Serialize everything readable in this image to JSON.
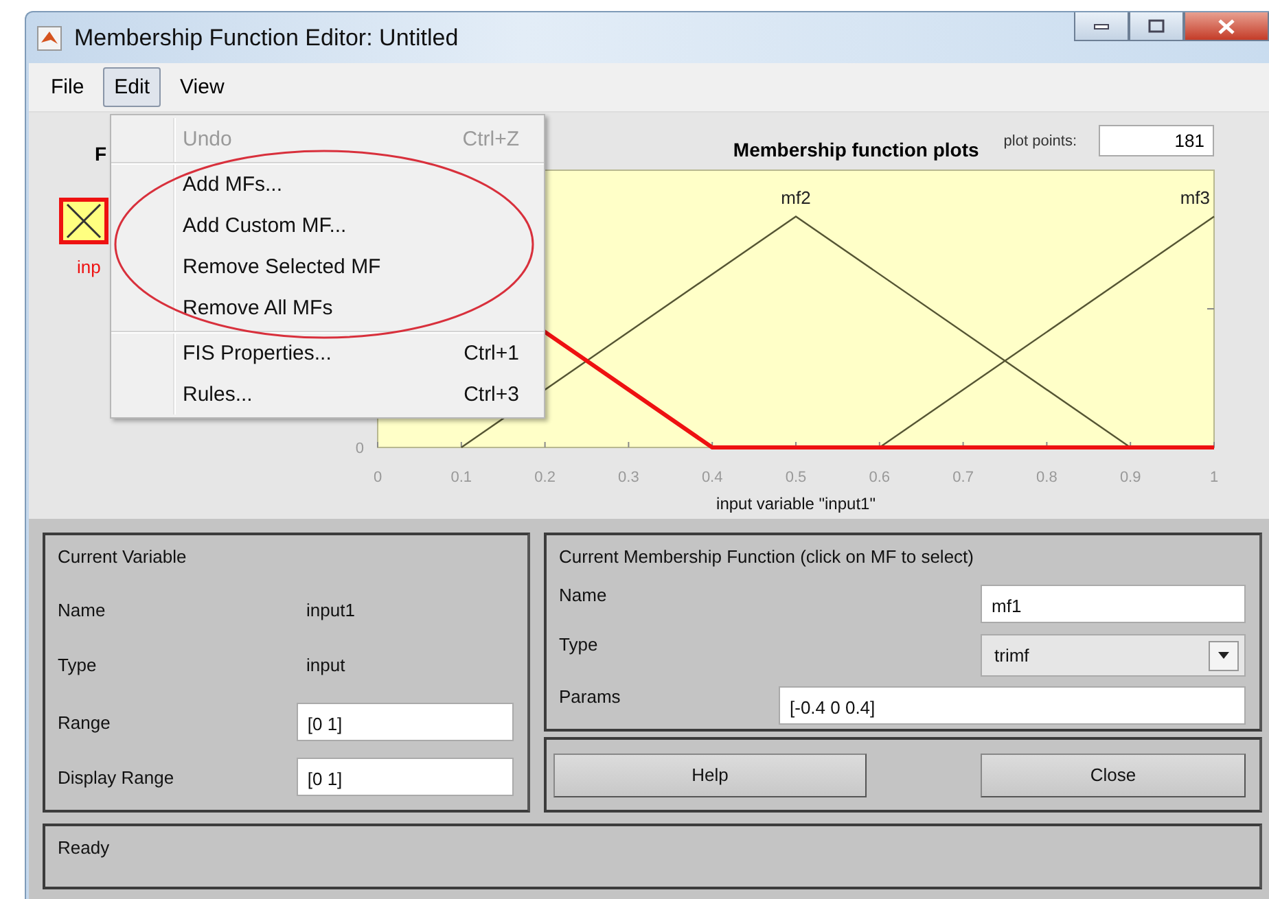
{
  "window": {
    "title": "Membership Function Editor: Untitled"
  },
  "menu_bar": [
    {
      "label": "File",
      "selected": false
    },
    {
      "label": "Edit",
      "selected": true
    },
    {
      "label": "View",
      "selected": false
    }
  ],
  "edit_menu": {
    "items": [
      {
        "label": "Undo",
        "shortcut": "Ctrl+Z",
        "disabled": true,
        "separator_before": false
      },
      {
        "label": "Add MFs...",
        "disabled": false,
        "separator_before": true
      },
      {
        "label": "Add Custom MF...",
        "disabled": false,
        "separator_before": false
      },
      {
        "label": "Remove Selected MF",
        "disabled": false,
        "separator_before": false
      },
      {
        "label": "Remove All MFs",
        "disabled": false,
        "separator_before": false
      },
      {
        "label": "FIS Properties...",
        "shortcut": "Ctrl+1",
        "disabled": false,
        "separator_before": true
      },
      {
        "label": "Rules...",
        "shortcut": "Ctrl+3",
        "disabled": false,
        "separator_before": false
      }
    ]
  },
  "fis_panel": {
    "title": "F",
    "variable": {
      "label": "inp",
      "selected": true
    }
  },
  "plot": {
    "title": "Membership function plots",
    "plot_points_label": "plot points:",
    "plot_points": "181",
    "function_labels": [
      "mf2",
      "mf3"
    ],
    "x_tick_labels": [
      "0",
      "0.1",
      "0.2",
      "0.3",
      "0.4",
      "0.5",
      "0.6",
      "0.7",
      "0.8",
      "0.9",
      "1"
    ],
    "y_tick_label": "0",
    "xlabel": "input variable \"input1\""
  },
  "current_variable": {
    "title": "Current Variable",
    "name_label": "Name",
    "name": "input1",
    "type_label": "Type",
    "type": "input",
    "range_label": "Range",
    "range": "[0 1]",
    "display_range_label": "Display Range",
    "display_range": "[0 1]"
  },
  "current_mf": {
    "title": "Current Membership Function (click on MF to select)",
    "name_label": "Name",
    "name": "mf1",
    "type_label": "Type",
    "type": "trimf",
    "params_label": "Params",
    "params": "[-0.4 0 0.4]"
  },
  "buttons": [
    "Help",
    "Close"
  ],
  "status": "Ready"
}
